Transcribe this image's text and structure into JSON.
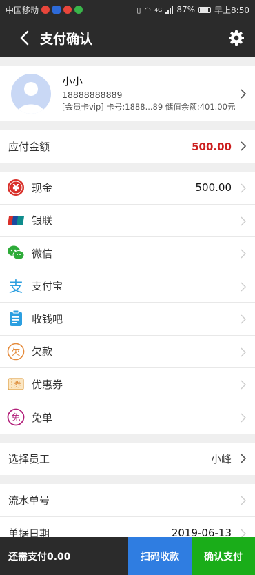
{
  "status_bar": {
    "carrier": "中国移动",
    "network": "4G",
    "battery": "87%",
    "time": "早上8:50"
  },
  "header": {
    "title": "支付确认"
  },
  "member": {
    "name": "小小",
    "phone": "18888888889",
    "card_info": "[会员卡vip] 卡号:1888...89 储值余额:401.00元"
  },
  "amount_due": {
    "label": "应付金额",
    "value": "500.00"
  },
  "payment_methods": [
    {
      "label": "现金",
      "value": "500.00",
      "icon": "cash-icon"
    },
    {
      "label": "银联",
      "value": "",
      "icon": "unionpay-icon"
    },
    {
      "label": "微信",
      "value": "",
      "icon": "wechat-icon"
    },
    {
      "label": "支付宝",
      "value": "",
      "icon": "alipay-icon"
    },
    {
      "label": "收钱吧",
      "value": "",
      "icon": "shouqianba-icon"
    },
    {
      "label": "欠款",
      "value": "",
      "icon": "debt-icon"
    },
    {
      "label": "优惠券",
      "value": "",
      "icon": "coupon-icon"
    },
    {
      "label": "免单",
      "value": "",
      "icon": "free-order-icon"
    }
  ],
  "employee": {
    "label": "选择员工",
    "value": "小峰"
  },
  "misc": {
    "serial_label": "流水单号",
    "date_label": "单据日期",
    "date_value": "2019-06-13"
  },
  "bottom": {
    "need_pay": "还需支付0.00",
    "scan_label": "扫码收款",
    "confirm_label": "确认支付"
  },
  "colors": {
    "dark": "#2b2b2b",
    "amount_red": "#cc1f1f",
    "scan_blue": "#2f7de1",
    "confirm_green": "#1aad19"
  }
}
